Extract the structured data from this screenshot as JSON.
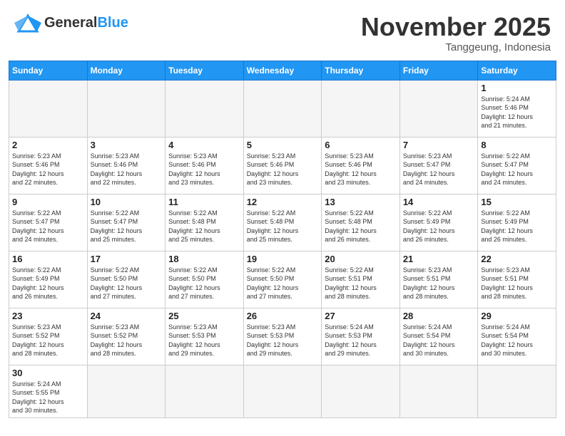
{
  "header": {
    "logo_general": "General",
    "logo_blue": "Blue",
    "month_title": "November 2025",
    "subtitle": "Tanggeung, Indonesia"
  },
  "weekdays": [
    "Sunday",
    "Monday",
    "Tuesday",
    "Wednesday",
    "Thursday",
    "Friday",
    "Saturday"
  ],
  "cells": [
    [
      {
        "day": "",
        "text": "",
        "empty": true
      },
      {
        "day": "",
        "text": "",
        "empty": true
      },
      {
        "day": "",
        "text": "",
        "empty": true
      },
      {
        "day": "",
        "text": "",
        "empty": true
      },
      {
        "day": "",
        "text": "",
        "empty": true
      },
      {
        "day": "",
        "text": "",
        "empty": true
      },
      {
        "day": "1",
        "text": "Sunrise: 5:24 AM\nSunset: 5:46 PM\nDaylight: 12 hours\nand 21 minutes."
      }
    ],
    [
      {
        "day": "2",
        "text": "Sunrise: 5:23 AM\nSunset: 5:46 PM\nDaylight: 12 hours\nand 22 minutes."
      },
      {
        "day": "3",
        "text": "Sunrise: 5:23 AM\nSunset: 5:46 PM\nDaylight: 12 hours\nand 22 minutes."
      },
      {
        "day": "4",
        "text": "Sunrise: 5:23 AM\nSunset: 5:46 PM\nDaylight: 12 hours\nand 23 minutes."
      },
      {
        "day": "5",
        "text": "Sunrise: 5:23 AM\nSunset: 5:46 PM\nDaylight: 12 hours\nand 23 minutes."
      },
      {
        "day": "6",
        "text": "Sunrise: 5:23 AM\nSunset: 5:46 PM\nDaylight: 12 hours\nand 23 minutes."
      },
      {
        "day": "7",
        "text": "Sunrise: 5:23 AM\nSunset: 5:47 PM\nDaylight: 12 hours\nand 24 minutes."
      },
      {
        "day": "8",
        "text": "Sunrise: 5:22 AM\nSunset: 5:47 PM\nDaylight: 12 hours\nand 24 minutes."
      }
    ],
    [
      {
        "day": "9",
        "text": "Sunrise: 5:22 AM\nSunset: 5:47 PM\nDaylight: 12 hours\nand 24 minutes."
      },
      {
        "day": "10",
        "text": "Sunrise: 5:22 AM\nSunset: 5:47 PM\nDaylight: 12 hours\nand 25 minutes."
      },
      {
        "day": "11",
        "text": "Sunrise: 5:22 AM\nSunset: 5:48 PM\nDaylight: 12 hours\nand 25 minutes."
      },
      {
        "day": "12",
        "text": "Sunrise: 5:22 AM\nSunset: 5:48 PM\nDaylight: 12 hours\nand 25 minutes."
      },
      {
        "day": "13",
        "text": "Sunrise: 5:22 AM\nSunset: 5:48 PM\nDaylight: 12 hours\nand 26 minutes."
      },
      {
        "day": "14",
        "text": "Sunrise: 5:22 AM\nSunset: 5:49 PM\nDaylight: 12 hours\nand 26 minutes."
      },
      {
        "day": "15",
        "text": "Sunrise: 5:22 AM\nSunset: 5:49 PM\nDaylight: 12 hours\nand 26 minutes."
      }
    ],
    [
      {
        "day": "16",
        "text": "Sunrise: 5:22 AM\nSunset: 5:49 PM\nDaylight: 12 hours\nand 26 minutes."
      },
      {
        "day": "17",
        "text": "Sunrise: 5:22 AM\nSunset: 5:50 PM\nDaylight: 12 hours\nand 27 minutes."
      },
      {
        "day": "18",
        "text": "Sunrise: 5:22 AM\nSunset: 5:50 PM\nDaylight: 12 hours\nand 27 minutes."
      },
      {
        "day": "19",
        "text": "Sunrise: 5:22 AM\nSunset: 5:50 PM\nDaylight: 12 hours\nand 27 minutes."
      },
      {
        "day": "20",
        "text": "Sunrise: 5:22 AM\nSunset: 5:51 PM\nDaylight: 12 hours\nand 28 minutes."
      },
      {
        "day": "21",
        "text": "Sunrise: 5:23 AM\nSunset: 5:51 PM\nDaylight: 12 hours\nand 28 minutes."
      },
      {
        "day": "22",
        "text": "Sunrise: 5:23 AM\nSunset: 5:51 PM\nDaylight: 12 hours\nand 28 minutes."
      }
    ],
    [
      {
        "day": "23",
        "text": "Sunrise: 5:23 AM\nSunset: 5:52 PM\nDaylight: 12 hours\nand 28 minutes."
      },
      {
        "day": "24",
        "text": "Sunrise: 5:23 AM\nSunset: 5:52 PM\nDaylight: 12 hours\nand 28 minutes."
      },
      {
        "day": "25",
        "text": "Sunrise: 5:23 AM\nSunset: 5:53 PM\nDaylight: 12 hours\nand 29 minutes."
      },
      {
        "day": "26",
        "text": "Sunrise: 5:23 AM\nSunset: 5:53 PM\nDaylight: 12 hours\nand 29 minutes."
      },
      {
        "day": "27",
        "text": "Sunrise: 5:24 AM\nSunset: 5:53 PM\nDaylight: 12 hours\nand 29 minutes."
      },
      {
        "day": "28",
        "text": "Sunrise: 5:24 AM\nSunset: 5:54 PM\nDaylight: 12 hours\nand 30 minutes."
      },
      {
        "day": "29",
        "text": "Sunrise: 5:24 AM\nSunset: 5:54 PM\nDaylight: 12 hours\nand 30 minutes."
      }
    ],
    [
      {
        "day": "30",
        "text": "Sunrise: 5:24 AM\nSunset: 5:55 PM\nDaylight: 12 hours\nand 30 minutes."
      },
      {
        "day": "",
        "text": "",
        "empty": true
      },
      {
        "day": "",
        "text": "",
        "empty": true
      },
      {
        "day": "",
        "text": "",
        "empty": true
      },
      {
        "day": "",
        "text": "",
        "empty": true
      },
      {
        "day": "",
        "text": "",
        "empty": true
      },
      {
        "day": "",
        "text": "",
        "empty": true
      }
    ]
  ]
}
